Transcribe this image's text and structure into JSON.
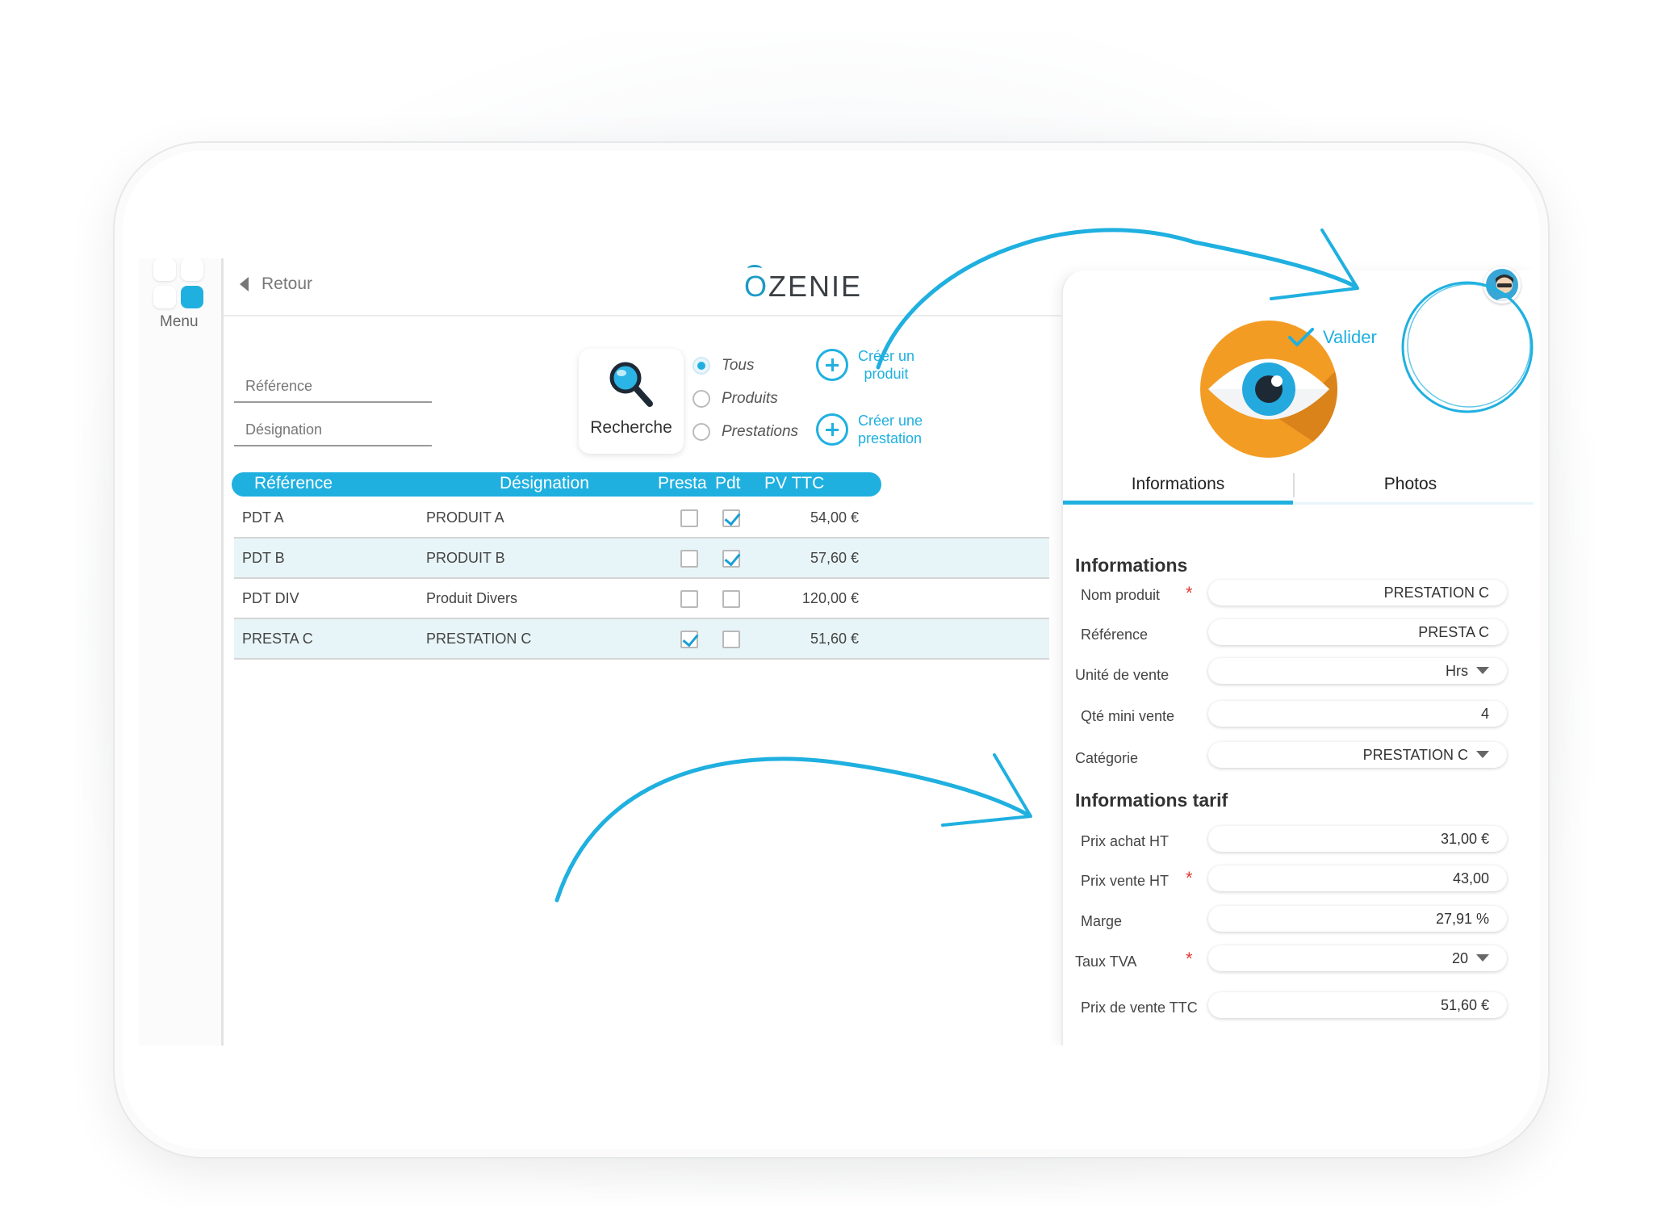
{
  "app": {
    "brand": "OZENIE",
    "brand_first": "O",
    "brand_rest": "ZENIE"
  },
  "rail": {
    "menu_label": "Menu"
  },
  "header": {
    "back_label": "Retour"
  },
  "search": {
    "reference_placeholder": "Référence",
    "designation_placeholder": "Désignation",
    "button_label": "Recherche",
    "filters": [
      {
        "label": "Tous",
        "selected": true
      },
      {
        "label": "Produits",
        "selected": false
      },
      {
        "label": "Prestations",
        "selected": false
      }
    ],
    "create_product": [
      "Créer un",
      "produit"
    ],
    "create_service": [
      "Créer une",
      "prestation"
    ]
  },
  "table": {
    "columns": [
      "Référence",
      "Désignation",
      "Presta",
      "Pdt",
      "PV TTC"
    ],
    "rows": [
      {
        "reference": "PDT A",
        "designation": "PRODUIT A",
        "presta": false,
        "pdt": true,
        "pv_ttc": "54,00 €"
      },
      {
        "reference": "PDT B",
        "designation": "PRODUIT B",
        "presta": false,
        "pdt": true,
        "pv_ttc": "57,60 €"
      },
      {
        "reference": "PDT DIV",
        "designation": "Produit Divers",
        "presta": false,
        "pdt": false,
        "pv_ttc": "120,00 €"
      },
      {
        "reference": "PRESTA C",
        "designation": "PRESTATION C",
        "presta": true,
        "pdt": false,
        "pv_ttc": "51,60 €"
      }
    ]
  },
  "detail": {
    "validate_label": "Valider",
    "tabs": [
      "Informations",
      "Photos"
    ],
    "section_info": "Informations",
    "section_tarif": "Informations tarif",
    "fields": {
      "nom_produit": {
        "label": "Nom produit",
        "value": "PRESTATION C"
      },
      "reference": {
        "label": "Référence",
        "value": "PRESTA C"
      },
      "unite_vente": {
        "label": "Unité de vente",
        "value": "Hrs"
      },
      "qte_mini": {
        "label": "Qté mini vente",
        "value": "4"
      },
      "categorie": {
        "label": "Catégorie",
        "value": "PRESTATION C"
      },
      "prix_achat": {
        "label": "Prix achat HT",
        "value": "31,00 €"
      },
      "prix_vente": {
        "label": "Prix vente HT",
        "value": "43,00"
      },
      "marge": {
        "label": "Marge",
        "value": "27,91 %"
      },
      "taux_tva": {
        "label": "Taux TVA",
        "value": "20"
      },
      "prix_ttc": {
        "label": "Prix de vente TTC",
        "value": "51,60 €"
      }
    },
    "required_mark": "*"
  },
  "colors": {
    "accent": "#1fb0e0",
    "required": "#e53935",
    "eye_bg": "#f39c24",
    "row_alt": "#e8f5f8"
  },
  "icons": [
    "menu-grid-icon",
    "back-arrow-icon",
    "magnifier-icon",
    "plus-circle-icon",
    "eye-icon",
    "check-icon",
    "avatar-icon",
    "dropdown-caret-icon"
  ]
}
